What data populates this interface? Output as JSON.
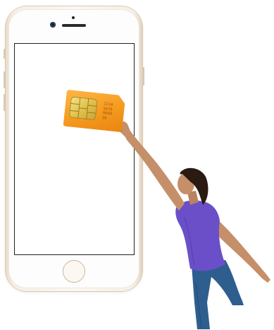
{
  "scene": {
    "subject": "woman-inserting-sim-card-into-smartphone"
  },
  "phone": {
    "color": "#f6efe6",
    "frame_accent": "#d8c8b2",
    "screen_color": "#ffffff"
  },
  "sim_card": {
    "number": "1234\n5678\n0000\n90",
    "color": "#f59a1e",
    "chip_color": "#e1c14d"
  },
  "person": {
    "shirt_color": "#6a4fc8",
    "jeans_color": "#2e5e8e",
    "skin_color": "#c58f6a",
    "hair_color": "#2a1a12"
  }
}
